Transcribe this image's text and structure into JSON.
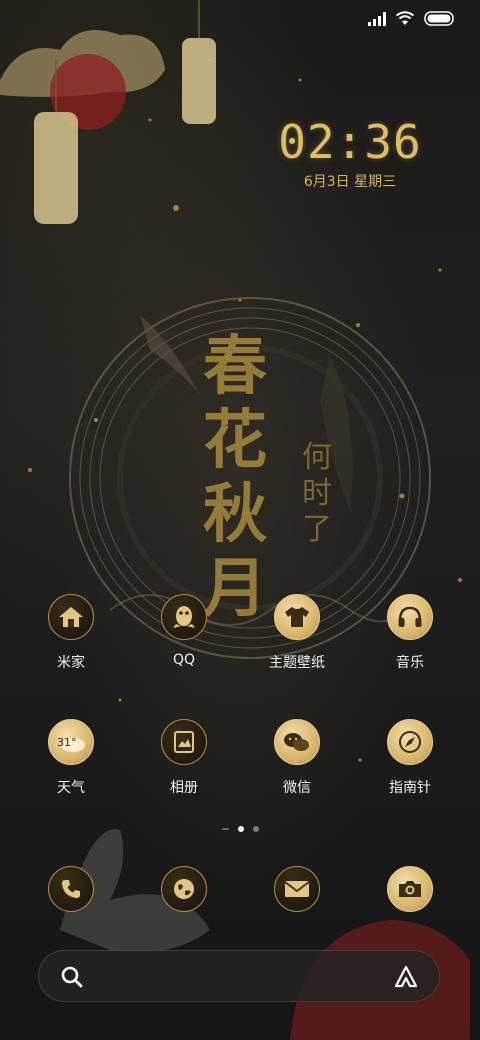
{
  "status_bar": {
    "signal_icon": "signal-icon",
    "wifi_icon": "wifi-icon",
    "battery_icon": "battery-icon"
  },
  "clock": {
    "time": "02:36",
    "date": "6月3日 星期三"
  },
  "apps": [
    {
      "label": "米家",
      "icon": "home-icon"
    },
    {
      "label": "QQ",
      "icon": "penguin-icon"
    },
    {
      "label": "主题壁纸",
      "icon": "tshirt-icon"
    },
    {
      "label": "音乐",
      "icon": "headphones-icon"
    },
    {
      "label": "天气",
      "icon": "weather-icon",
      "badge": "31°"
    },
    {
      "label": "相册",
      "icon": "photo-icon"
    },
    {
      "label": "微信",
      "icon": "chat-icon"
    },
    {
      "label": "指南针",
      "icon": "compass-icon"
    }
  ],
  "dock": [
    {
      "name": "phone",
      "icon": "phone-icon"
    },
    {
      "name": "browser",
      "icon": "globe-icon"
    },
    {
      "name": "messages",
      "icon": "envelope-icon"
    },
    {
      "name": "camera",
      "icon": "camera-icon"
    }
  ],
  "page_indicator": {
    "pages": 3,
    "current": 2
  },
  "wallpaper": {
    "calligraphy_main": "春花秋月",
    "calligraphy_side": "何时了"
  },
  "colors": {
    "gold": "#e0bd63",
    "gold_dark": "#b08b3a",
    "background": "#1b1a18"
  }
}
